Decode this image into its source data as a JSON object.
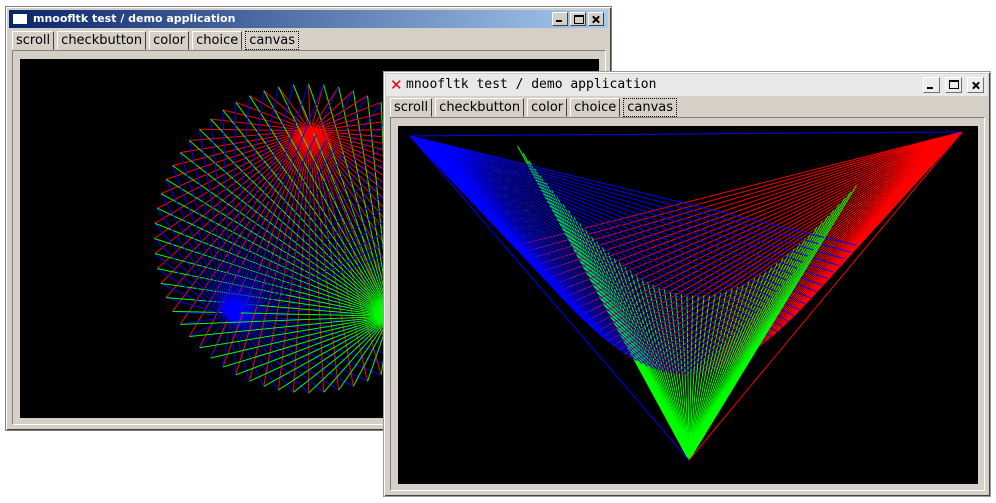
{
  "windows": [
    {
      "title": "mnoofltk test / demo application",
      "tabs": [
        "scroll",
        "checkbutton",
        "color",
        "choice",
        "canvas"
      ],
      "active_tab": "canvas",
      "window_controls": [
        "minimize-icon",
        "maximize-icon",
        "close-icon"
      ]
    },
    {
      "title": "mnoofltk test / demo application",
      "tabs": [
        "scroll",
        "checkbutton",
        "color",
        "choice",
        "canvas"
      ],
      "active_tab": "canvas",
      "title_icon": "x-app-icon",
      "window_controls": [
        "minimize-icon",
        "maximize-icon",
        "close-icon"
      ]
    }
  ],
  "colors": {
    "canvas_bg": "#000000",
    "red": "#ff0000",
    "green": "#00ff00",
    "blue": "#0000ff"
  }
}
